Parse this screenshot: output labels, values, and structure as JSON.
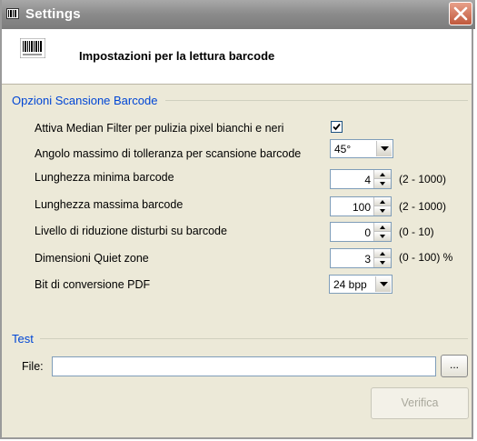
{
  "window": {
    "title": "Settings"
  },
  "header": {
    "title": "Impostazioni per la lettura barcode"
  },
  "scan_group": {
    "title": "Opzioni Scansione Barcode",
    "median_filter": {
      "label": "Attiva Median Filter per pulizia pixel bianchi e neri",
      "checked": true
    },
    "angle": {
      "label": "Angolo massimo di tolleranza per scansione barcode",
      "value": "45°"
    },
    "min_length": {
      "label": "Lunghezza minima barcode",
      "value": "4",
      "range": "(2 - 1000)"
    },
    "max_length": {
      "label": "Lunghezza massima barcode",
      "value": "100",
      "range": "(2 - 1000)"
    },
    "noise": {
      "label": "Livello di riduzione disturbi su barcode",
      "value": "0",
      "range": "(0 - 10)"
    },
    "quiet_zone": {
      "label": "Dimensioni Quiet zone",
      "value": "3",
      "range": "(0 - 100) %"
    },
    "pdf_bits": {
      "label": "Bit di conversione PDF",
      "value": "24 bpp"
    }
  },
  "test_group": {
    "title": "Test",
    "file_label": "File:",
    "file_value": "",
    "browse_label": "...",
    "verify_label": "Verifica"
  },
  "icons": {
    "title": "barcode-icon",
    "close": "close-icon",
    "header": "barcode-icon"
  },
  "colors": {
    "group_title": "#0046d5",
    "close_button": "#c0583c",
    "titlebar": "#8a8a8a"
  }
}
